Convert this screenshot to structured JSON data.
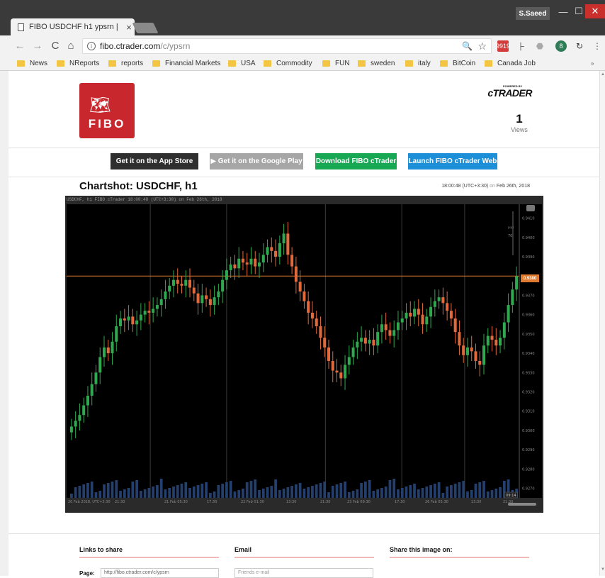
{
  "window": {
    "tab_title": "FIBO USDCHF h1 ypsrn |",
    "tab_close": "×",
    "user": "S.Saeed",
    "min": "—",
    "max": "☐",
    "close": "✕"
  },
  "toolbar": {
    "back_icon": "←",
    "forward_icon": "→",
    "reload_icon": "C",
    "home_icon": "⌂",
    "info_icon": "i",
    "url_host": "fibo.ctrader.com",
    "url_path": "/c/ypsrn",
    "zoom_icon": "🔍",
    "star_icon": "☆",
    "ext_mail_badge": "9919",
    "ext_pulse": "⺊",
    "ext_puzzle": "⬣",
    "ext_green_badge": "8",
    "ext_sync": "↻",
    "menu_icon": "⋮"
  },
  "bookmarks": {
    "items": [
      "News",
      "NReports",
      "reports",
      "Financial Markets",
      "USA",
      "Commodity",
      "FUN",
      "sweden",
      "italy",
      "BitCoin",
      "Canada Job"
    ],
    "more": "»"
  },
  "header": {
    "logo_text": "FIBO",
    "logo_map": "🗺",
    "powered_by": "POWERED BY",
    "brand": "cTRADER",
    "views_count": "1",
    "views_label": "Views"
  },
  "buttons": {
    "appstore": " Get it on the App Store",
    "gplay": "▶ Get it on the Google Play",
    "download": "Download FIBO cTrader",
    "launch": "Launch FIBO cTrader Web"
  },
  "chartshot": {
    "title": "Chartshot: USDCHF, h1",
    "time": "18:00:48 (UTC+3:30)",
    "on_text": " on ",
    "date": "Feb 26th, 2018"
  },
  "chart": {
    "header": "USDCHF, h1 FIBO cTrader 18:00:48 (UTC+3:30) on Feb 26th, 2018",
    "current_price": "0.9380",
    "corner_label": "70",
    "corner_label2": "pips"
  },
  "chart_data": {
    "type": "candlestick",
    "symbol": "USDCHF",
    "timeframe": "h1",
    "y_ticks": [
      "0.9410",
      "0.9400",
      "0.9390",
      "0.9380",
      "0.9370",
      "0.9360",
      "0.9350",
      "0.9340",
      "0.9330",
      "0.9320",
      "0.9310",
      "0.9300",
      "0.9290",
      "0.9280",
      "0.9270"
    ],
    "x_ticks": [
      "20 Feb 2018, UTC+3:30",
      "21:30",
      "21 Feb 05:30",
      "17:30",
      "22 Feb 01:30",
      "13:30",
      "21:30",
      "23 Feb 09:30",
      "17:30",
      "26 Feb 05:30",
      "13:30",
      "21:30"
    ],
    "ylim": [
      0.9268,
      0.9415
    ],
    "current_price": 0.938,
    "current_bar_label": "09:14",
    "closes": [
      0.9302,
      0.9305,
      0.9308,
      0.9313,
      0.9318,
      0.9324,
      0.933,
      0.9338,
      0.9343,
      0.934,
      0.9346,
      0.9354,
      0.9358,
      0.9357,
      0.9359,
      0.9355,
      0.9357,
      0.936,
      0.9362,
      0.9361,
      0.9363,
      0.9365,
      0.9368,
      0.9372,
      0.9375,
      0.9378,
      0.9376,
      0.9375,
      0.9378,
      0.9374,
      0.9371,
      0.9366,
      0.937,
      0.9368,
      0.9365,
      0.9369,
      0.9372,
      0.9378,
      0.9383,
      0.9386,
      0.9384,
      0.9389,
      0.9387,
      0.9386,
      0.9389,
      0.9385,
      0.9387,
      0.9391,
      0.9395,
      0.9393,
      0.939,
      0.9397,
      0.9402,
      0.9391,
      0.9385,
      0.9377,
      0.9372,
      0.9367,
      0.9361,
      0.9358,
      0.9354,
      0.9348,
      0.9343,
      0.9336,
      0.9331,
      0.933,
      0.9327,
      0.9334,
      0.9338,
      0.9343,
      0.9346,
      0.9348,
      0.9345,
      0.9347,
      0.9344,
      0.9351,
      0.9355,
      0.9352,
      0.9349,
      0.9352,
      0.9356,
      0.9358,
      0.9361,
      0.9359,
      0.9363,
      0.936,
      0.9355,
      0.9359,
      0.9364,
      0.9367,
      0.9369,
      0.9366,
      0.9362,
      0.9358,
      0.9351,
      0.9344,
      0.9339,
      0.9343,
      0.9341,
      0.9336,
      0.9334,
      0.9344,
      0.9349,
      0.9347,
      0.9344,
      0.9348,
      0.9356,
      0.9365,
      0.9373,
      0.938
    ]
  }
}
